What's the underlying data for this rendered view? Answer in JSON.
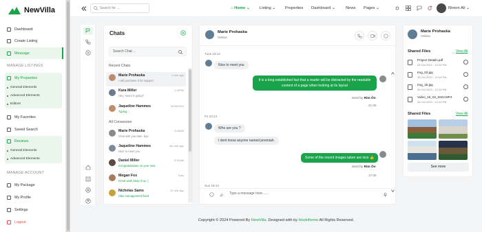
{
  "app": {
    "name": "NewVilla"
  },
  "sidebar": {
    "items": [
      {
        "label": "Dashboard"
      },
      {
        "label": "Create Listing"
      },
      {
        "label": "Message"
      }
    ],
    "section_manage_listings": "MANAGE LISTINGS",
    "my_properties": {
      "label": "My Properties",
      "sub": [
        "General Elements",
        "Advanced Elements",
        "Editors"
      ]
    },
    "my_favorites": "My Favorites",
    "saved_search": "Saved Search",
    "reviews": {
      "label": "Reviews",
      "sub": [
        "General Elements",
        "Advanced Elements"
      ]
    },
    "section_manage_account": "MANAGE ACCOUNT",
    "my_package": "My Package",
    "my_profile": "My Profile",
    "settings": "Settings",
    "logout": "Logout"
  },
  "topbar": {
    "search_placeholder": "Search for ...",
    "nav": [
      "Home",
      "Listing",
      "Properties",
      "Dashboard",
      "News",
      "Pages"
    ],
    "user": "Rimon Ali"
  },
  "chats": {
    "title": "Chats",
    "search_placeholder": "Search Chat ...",
    "recent_label": "Recent Chats",
    "recent": [
      {
        "name": "Marie Prohaska",
        "message": "I will purchase it for support",
        "time": "2 min ago"
      },
      {
        "name": "Kara Miller",
        "message": "Hey, how's it going?",
        "time": "1:20PM"
      },
      {
        "name": "Jaqueline Hammes",
        "message": "Typing...",
        "time": "14/06/2024"
      }
    ],
    "all_label": "All Conversion",
    "all": [
      {
        "name": "Marie Prohaska",
        "message": "Chat with you later, bye",
        "time": "9:45AM"
      },
      {
        "name": "Jaqueline Hammes",
        "message": "Nice to meet you",
        "time": "4th min ago"
      },
      {
        "name": "Daniel Miller",
        "message": "Congratulations on your new",
        "time": "8:31AM"
      },
      {
        "name": "Megan Fox",
        "message": "Great work keep it up :)",
        "time": "Tues"
      },
      {
        "name": "Nicholas Sams",
        "message": "Hiko management fixed",
        "time": "22 min ago"
      }
    ]
  },
  "conversation": {
    "contact": "Marie Prohaska",
    "status": "Online",
    "day1": "Tues 23:14",
    "m1": "Nice to meet you",
    "m2_line1": "It is a long established fact that a reader will be distracted by the readable",
    "m2_line2": "content of a page when looking at its layout",
    "sent_by": "Sent by",
    "sender": "Rim Ôn",
    "t1": "21:05",
    "day2": "Fri 23:14",
    "m3": "Who are you ?",
    "m4": "I dont know anyone named jeremiah.",
    "m5": "Some of the recent images taken are nice 👍",
    "t2": "17:05",
    "day3": "Sun 18:14",
    "input_placeholder": "Type a message here......"
  },
  "info": {
    "name": "Marie Prohaska",
    "status": "Online",
    "shared_files": "Shared Files",
    "view_all": "View All",
    "files": [
      {
        "name": "Project Details.pdf",
        "date": "26 Oct 2022 - 12:24 PM"
      },
      {
        "name": "Img_02.jpg",
        "date": "26 Oct 2022 - 12:24 PM"
      },
      {
        "name": "Img_15.jpg",
        "date": "26 Oct 2022 - 12:24 PM"
      },
      {
        "name": "Video_15_02_2022.MP4",
        "date": "26 Oct 2022 - 12:24 PM"
      }
    ],
    "shared_images": "Shared Files",
    "see_more": "See more"
  },
  "footer": {
    "pre": "Copyright © 2024 Powered By ",
    "brand": "NewVilla",
    "mid": ". Designed with  by ",
    "author": "Hooktheme",
    "post": " All Rights Reserved."
  },
  "colors": {
    "accent": "#1aa34a"
  }
}
